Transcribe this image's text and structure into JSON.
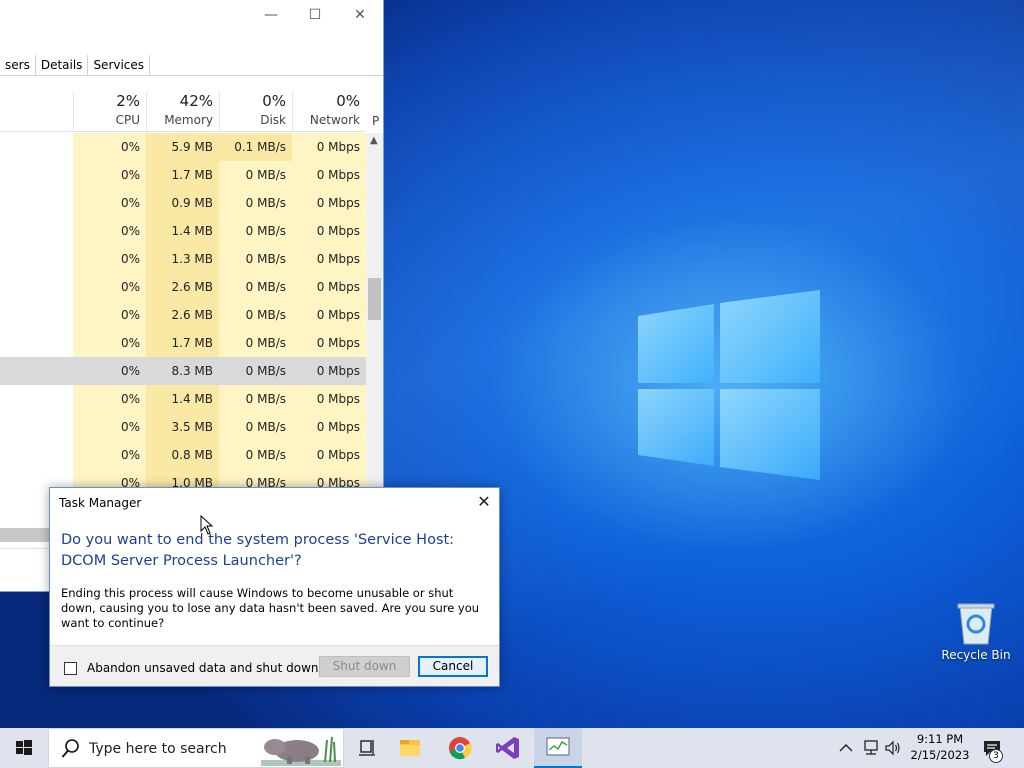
{
  "desktop": {
    "recycle_bin_label": "Recycle Bin"
  },
  "task_manager": {
    "tabs": [
      "sers",
      "Details",
      "Services"
    ],
    "columns": [
      {
        "percent": "2%",
        "name": "CPU"
      },
      {
        "percent": "42%",
        "name": "Memory"
      },
      {
        "percent": "0%",
        "name": "Disk"
      },
      {
        "percent": "0%",
        "name": "Network"
      }
    ],
    "partial_column": "P",
    "rows": [
      {
        "cpu": "0%",
        "mem": "5.9 MB",
        "disk": "0.1 MB/s",
        "net": "0 Mbps"
      },
      {
        "cpu": "0%",
        "mem": "1.7 MB",
        "disk": "0 MB/s",
        "net": "0 Mbps"
      },
      {
        "cpu": "0%",
        "mem": "0.9 MB",
        "disk": "0 MB/s",
        "net": "0 Mbps"
      },
      {
        "cpu": "0%",
        "mem": "1.4 MB",
        "disk": "0 MB/s",
        "net": "0 Mbps"
      },
      {
        "cpu": "0%",
        "mem": "1.3 MB",
        "disk": "0 MB/s",
        "net": "0 Mbps"
      },
      {
        "cpu": "0%",
        "mem": "2.6 MB",
        "disk": "0 MB/s",
        "net": "0 Mbps"
      },
      {
        "cpu": "0%",
        "mem": "2.6 MB",
        "disk": "0 MB/s",
        "net": "0 Mbps"
      },
      {
        "cpu": "0%",
        "mem": "1.7 MB",
        "disk": "0 MB/s",
        "net": "0 Mbps"
      },
      {
        "cpu": "0%",
        "mem": "8.3 MB",
        "disk": "0 MB/s",
        "net": "0 Mbps",
        "selected": true
      },
      {
        "cpu": "0%",
        "mem": "1.4 MB",
        "disk": "0 MB/s",
        "net": "0 Mbps"
      },
      {
        "cpu": "0%",
        "mem": "3.5 MB",
        "disk": "0 MB/s",
        "net": "0 Mbps"
      },
      {
        "cpu": "0%",
        "mem": "0.8 MB",
        "disk": "0 MB/s",
        "net": "0 Mbps"
      },
      {
        "cpu": "0%",
        "mem": "1.0 MB",
        "disk": "0 MB/s",
        "net": "0 Mbps"
      }
    ]
  },
  "dialog": {
    "title": "Task Manager",
    "main_instruction": "Do you want to end the system process 'Service Host: DCOM Server Process Launcher'?",
    "content": "Ending this process will cause Windows to become unusable or shut down, causing you to lose any data hasn't been saved. Are you sure you want to continue?",
    "checkbox_label": "Abandon unsaved data and shut down.",
    "checkbox_checked": false,
    "shutdown_label": "Shut down",
    "cancel_label": "Cancel"
  },
  "taskbar": {
    "search_placeholder": "Type here to search",
    "time": "9:11 PM",
    "date": "2/15/2023",
    "notification_count": "3"
  },
  "colors": {
    "accent": "#0078d7",
    "dialog_heading": "#1c3f95",
    "cell_highlight": "#fff4c4"
  }
}
